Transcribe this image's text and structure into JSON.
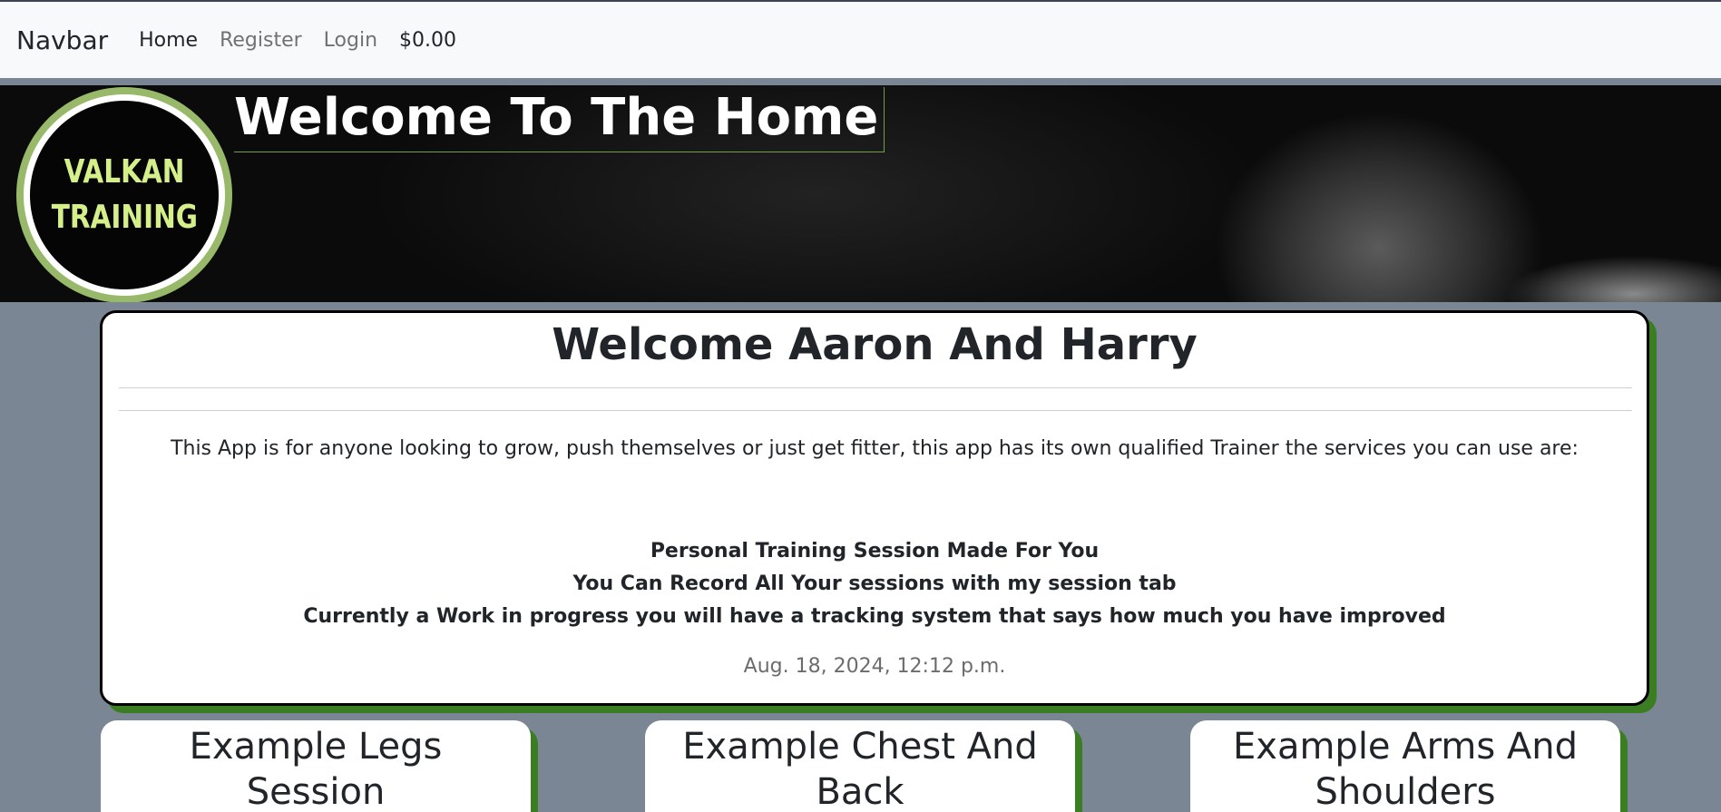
{
  "navbar": {
    "brand": "Navbar",
    "links": [
      {
        "label": "Home"
      },
      {
        "label": "Register"
      },
      {
        "label": "Login"
      },
      {
        "label": "$0.00"
      }
    ]
  },
  "hero": {
    "title": "Welcome To The Home",
    "logo": {
      "line1": "VALKAN",
      "line2": "TRAINING"
    }
  },
  "main": {
    "title": "Welcome Aaron And Harry",
    "intro": "This App is for anyone looking to grow, push themselves or just get fitter, this app has its own qualified Trainer the services you can use are:",
    "services": [
      "Personal Training Session Made For You",
      "You Can Record All Your sessions with my session tab",
      "Currently a Work in progress you will have a tracking system that says how much you have improved"
    ],
    "date": "Aug. 18, 2024, 12:12 p.m."
  },
  "sessions": [
    {
      "title": "Example Legs Session"
    },
    {
      "title": "Example Chest And Back"
    },
    {
      "title": "Example Arms And Shoulders"
    }
  ],
  "colors": {
    "page_bg": "#7a8694",
    "accent_green": "#3b7d23",
    "logo_text": "#d5f08a",
    "logo_ring": "#98b86a"
  }
}
